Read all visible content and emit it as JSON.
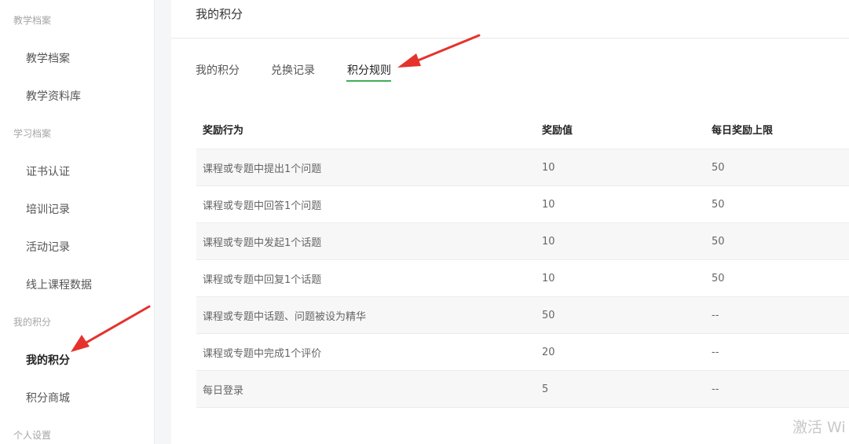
{
  "sidebar": {
    "groups": [
      {
        "label": "教学档案",
        "items": [
          "教学档案",
          "教学资料库"
        ]
      },
      {
        "label": "学习档案",
        "items": [
          "证书认证",
          "培训记录",
          "活动记录",
          "线上课程数据"
        ]
      },
      {
        "label": "我的积分",
        "items": [
          "我的积分",
          "积分商城"
        ]
      },
      {
        "label": "个人设置",
        "items": []
      }
    ],
    "active_item": "我的积分"
  },
  "main": {
    "title": "我的积分",
    "tabs": [
      {
        "label": "我的积分"
      },
      {
        "label": "兑换记录"
      },
      {
        "label": "积分规则"
      }
    ],
    "active_tab": "积分规则"
  },
  "rules_table": {
    "headers": [
      "奖励行为",
      "奖励值",
      "每日奖励上限"
    ],
    "rows": [
      {
        "action": "课程或专题中提出1个问题",
        "value": "10",
        "daily_limit": "50"
      },
      {
        "action": "课程或专题中回答1个问题",
        "value": "10",
        "daily_limit": "50"
      },
      {
        "action": "课程或专题中发起1个话题",
        "value": "10",
        "daily_limit": "50"
      },
      {
        "action": "课程或专题中回复1个话题",
        "value": "10",
        "daily_limit": "50"
      },
      {
        "action": "课程或专题中话题、问题被设为精华",
        "value": "50",
        "daily_limit": "--"
      },
      {
        "action": "课程或专题中完成1个评价",
        "value": "20",
        "daily_limit": "--"
      },
      {
        "action": "每日登录",
        "value": "5",
        "daily_limit": "--"
      }
    ]
  },
  "watermark": {
    "text": "激活 Wi"
  },
  "colors": {
    "accent_green": "#3fae5a",
    "annotation_red": "#e5322d",
    "row_stripe": "#f7f7f7"
  }
}
